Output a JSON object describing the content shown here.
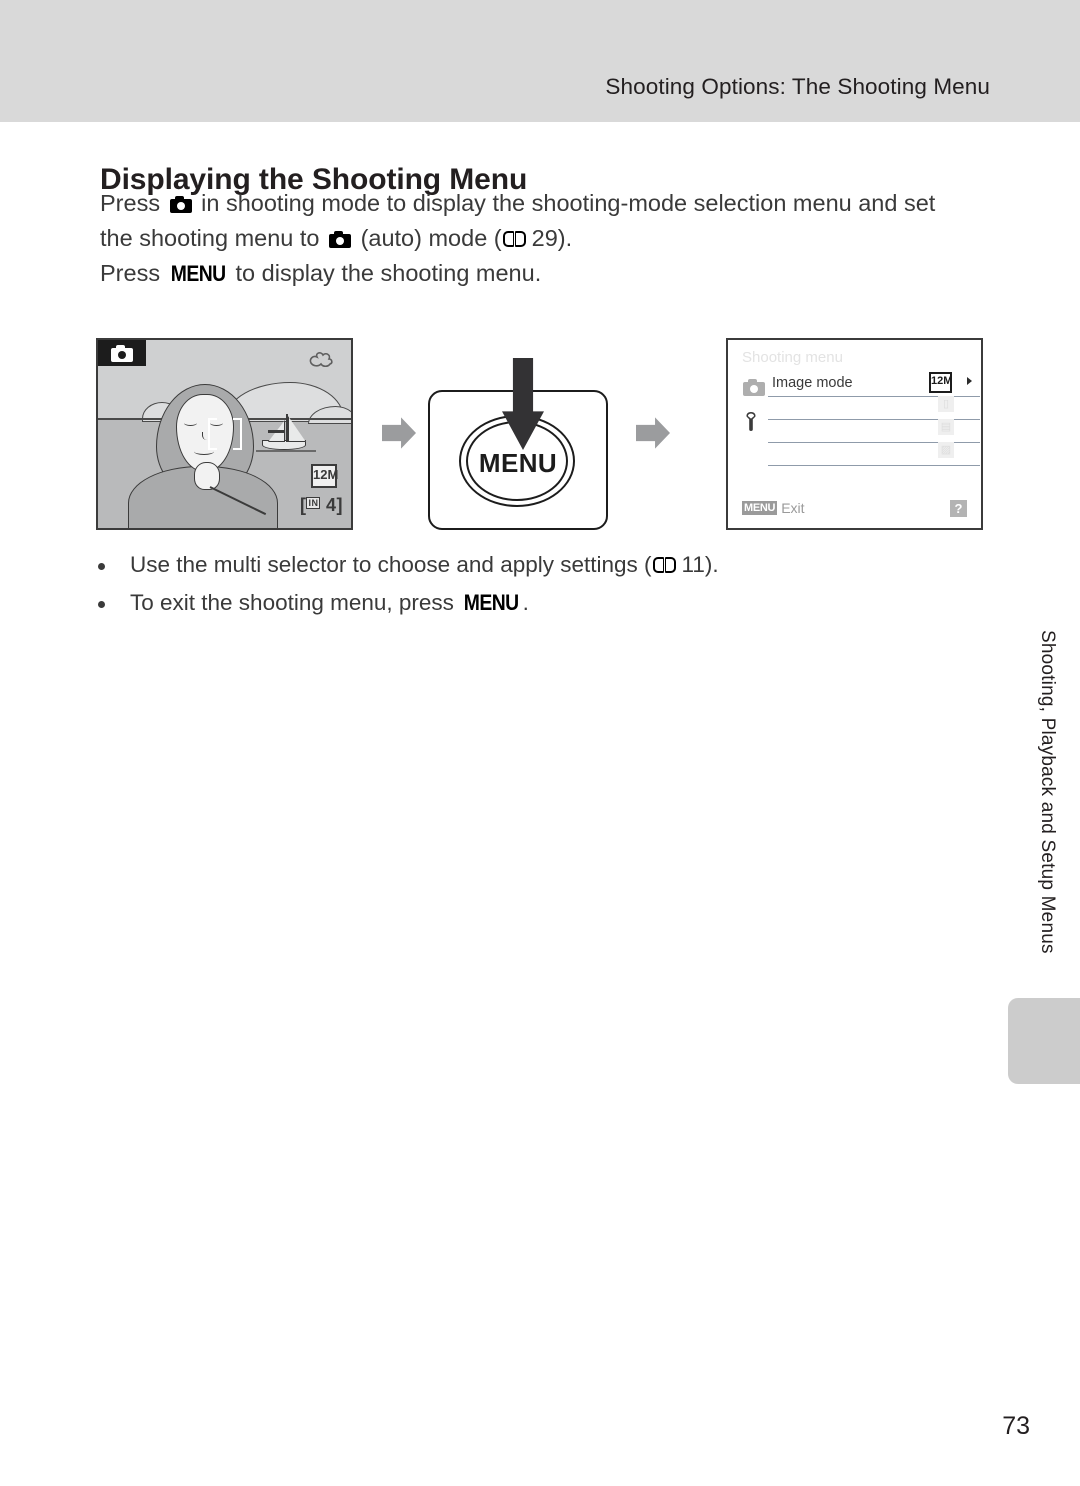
{
  "header": {
    "running_head": "Shooting Options: The Shooting Menu",
    "band_color": "#d9d9d9"
  },
  "page_title": "Displaying the Shooting Menu",
  "body": {
    "line1_pre": "Press",
    "line1_icon": "camera-icon",
    "line1_post": "in shooting mode to display the shooting-mode selection menu and set",
    "line2_pre": "the shooting menu to",
    "line2_icon": "camera-icon",
    "line2_mid": "(auto) mode (",
    "line2_ref_icon": "open-book-icon",
    "line2_ref_page": "29).",
    "line3_pre": "Press",
    "line3_glyph": "MENU",
    "line3_post": "to display the shooting menu."
  },
  "illustration": {
    "lcd_preview": {
      "mode_badge_icon": "camera-icon",
      "shake_warning_icon": "camera-shake-icon",
      "resolution_badge": "12M",
      "remaining_shots": "4",
      "internal_memory_label": "IN"
    },
    "arrow_1_icon": "right-arrow-icon",
    "menu_button": {
      "label": "MENU",
      "press_arrow_icon": "down-arrow-icon"
    },
    "arrow_2_icon": "right-arrow-icon",
    "menu_screen": {
      "title": "Shooting menu",
      "tab_shooting_icon": "camera-icon",
      "tab_setup_icon": "wrench-icon",
      "rows": [
        {
          "label": "Image mode",
          "badge": "12M",
          "chevron": true,
          "ghost": ""
        },
        {
          "label": "",
          "badge": "",
          "chevron": false,
          "ghost": "▯"
        },
        {
          "label": "",
          "badge": "",
          "chevron": false,
          "ghost": "▤"
        },
        {
          "label": "",
          "badge": "",
          "chevron": false,
          "ghost": "▨"
        }
      ],
      "footer_badge": "MENU",
      "footer_text": "Exit",
      "help_icon": "?"
    }
  },
  "bullets": [
    "Use the multi selector to choose and apply settings (  11).",
    "To exit the shooting menu, press MENU."
  ],
  "bullet_parts": {
    "b1_pre": "Use the multi selector to choose and apply settings (",
    "b1_icon": "open-book-icon",
    "b1_post": "11).",
    "b2_pre": "To exit the shooting menu, press",
    "b2_glyph": "MENU",
    "b2_post": "."
  },
  "chapter_label": "Shooting, Playback and Setup Menus",
  "page_number": "73"
}
